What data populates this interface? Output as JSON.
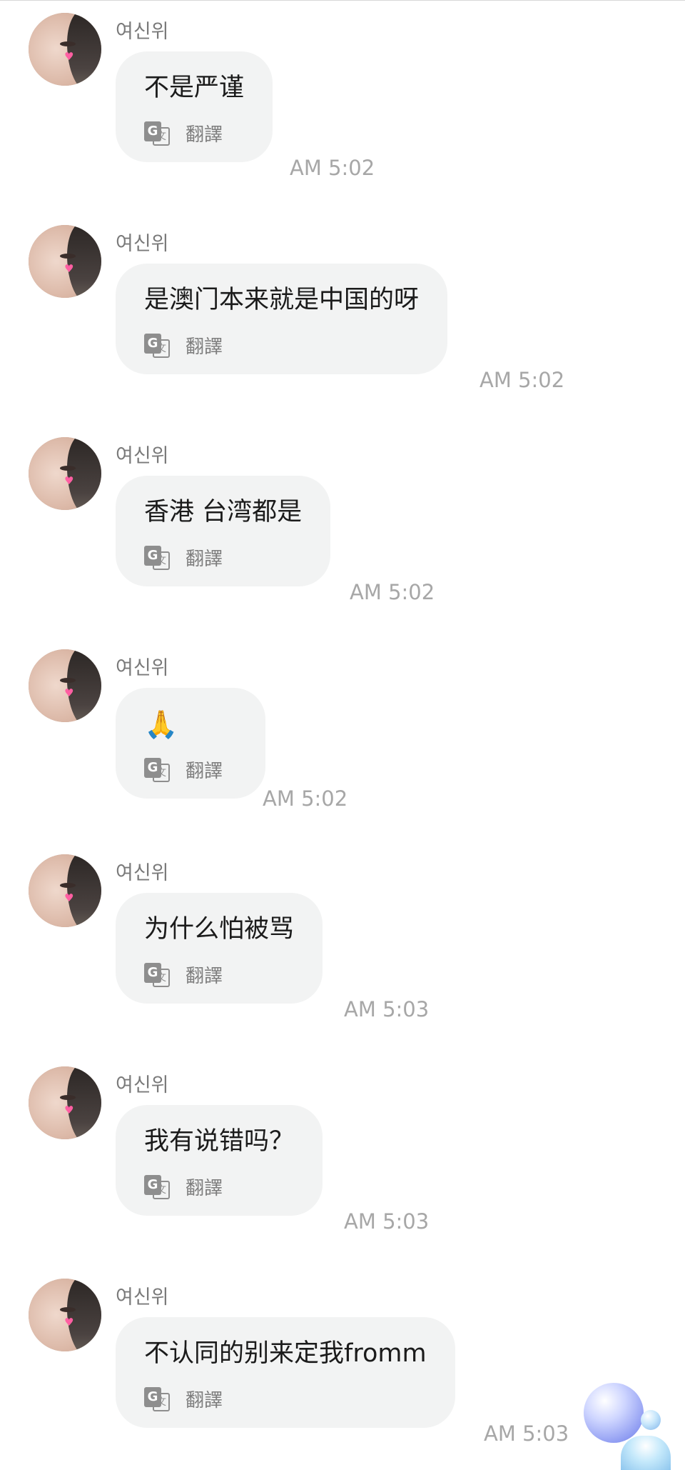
{
  "messages": [
    {
      "sender": "여신위",
      "text": "不是严谨",
      "translate_label": "翻譯",
      "time": "AM 5:02"
    },
    {
      "sender": "여신위",
      "text": "是澳门本来就是中国的呀",
      "translate_label": "翻譯",
      "time": "AM 5:02"
    },
    {
      "sender": "여신위",
      "text": "香港 台湾都是",
      "translate_label": "翻譯",
      "time": "AM 5:02"
    },
    {
      "sender": "여신위",
      "text": "🙏",
      "translate_label": "翻譯",
      "time": "AM 5:02"
    },
    {
      "sender": "여신위",
      "text": "为什么怕被骂",
      "translate_label": "翻譯",
      "time": "AM 5:03"
    },
    {
      "sender": "여신위",
      "text": "我有说错吗？",
      "translate_label": "翻譯",
      "time": "AM 5:03"
    },
    {
      "sender": "여신위",
      "text": "不认同的别来定我fromm",
      "translate_label": "翻譯",
      "time": "AM 5:03"
    }
  ],
  "icons": {
    "translate": "google-translate-icon",
    "assistant": "floating-assistant-orb-icon"
  }
}
